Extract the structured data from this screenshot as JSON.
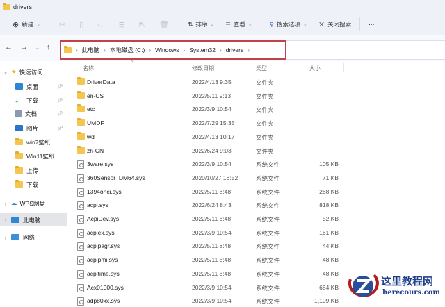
{
  "window": {
    "title": "drivers"
  },
  "toolbar": {
    "new_label": "新建",
    "sort_label": "排序",
    "view_label": "查看",
    "search_options_label": "搜索选项",
    "close_search_label": "关闭搜索",
    "more_label": "···"
  },
  "address": {
    "crumbs": [
      "此电脑",
      "本地磁盘 (C:)",
      "Windows",
      "System32",
      "drivers"
    ],
    "highlight_color": "#c0434c"
  },
  "sidebar": {
    "quick_access": "快速访问",
    "items": [
      {
        "label": "桌面",
        "icon": "desktop-icon",
        "pinned": true
      },
      {
        "label": "下载",
        "icon": "download-icon",
        "pinned": true
      },
      {
        "label": "文档",
        "icon": "document-icon",
        "pinned": true
      },
      {
        "label": "图片",
        "icon": "picture-icon",
        "pinned": true
      },
      {
        "label": "win7壁纸",
        "icon": "folder-icon"
      },
      {
        "label": "Win11壁纸",
        "icon": "folder-icon"
      },
      {
        "label": "上传",
        "icon": "folder-icon"
      },
      {
        "label": "下载",
        "icon": "folder-icon"
      }
    ],
    "wps": "WPS网盘",
    "this_pc": "此电脑",
    "network": "网络"
  },
  "columns": {
    "name": "名称",
    "date": "修改日期",
    "type": "类型",
    "size": "大小"
  },
  "files": [
    {
      "name": "DriverData",
      "date": "2022/4/13 9:35",
      "type": "文件夹",
      "size": "",
      "kind": "folder"
    },
    {
      "name": "en-US",
      "date": "2022/5/11 9:13",
      "type": "文件夹",
      "size": "",
      "kind": "folder"
    },
    {
      "name": "etc",
      "date": "2022/3/9 10:54",
      "type": "文件夹",
      "size": "",
      "kind": "folder"
    },
    {
      "name": "UMDF",
      "date": "2022/7/29 15:35",
      "type": "文件夹",
      "size": "",
      "kind": "folder"
    },
    {
      "name": "wd",
      "date": "2022/4/13 10:17",
      "type": "文件夹",
      "size": "",
      "kind": "folder"
    },
    {
      "name": "zh-CN",
      "date": "2022/6/24 9:03",
      "type": "文件夹",
      "size": "",
      "kind": "folder"
    },
    {
      "name": "3ware.sys",
      "date": "2022/3/9 10:54",
      "type": "系统文件",
      "size": "105 KB",
      "kind": "sys"
    },
    {
      "name": "360Sensor_DM64.sys",
      "date": "2020/10/27 16:52",
      "type": "系统文件",
      "size": "71 KB",
      "kind": "sys"
    },
    {
      "name": "1394ohci.sys",
      "date": "2022/5/11 8:48",
      "type": "系统文件",
      "size": "288 KB",
      "kind": "sys"
    },
    {
      "name": "acpi.sys",
      "date": "2022/6/24 8:43",
      "type": "系统文件",
      "size": "818 KB",
      "kind": "sys"
    },
    {
      "name": "AcpiDev.sys",
      "date": "2022/5/11 8:48",
      "type": "系统文件",
      "size": "52 KB",
      "kind": "sys"
    },
    {
      "name": "acpiex.sys",
      "date": "2022/3/9 10:54",
      "type": "系统文件",
      "size": "161 KB",
      "kind": "sys"
    },
    {
      "name": "acpipagr.sys",
      "date": "2022/5/11 8:48",
      "type": "系统文件",
      "size": "44 KB",
      "kind": "sys"
    },
    {
      "name": "acpipmi.sys",
      "date": "2022/5/11 8:48",
      "type": "系统文件",
      "size": "48 KB",
      "kind": "sys"
    },
    {
      "name": "acpitime.sys",
      "date": "2022/5/11 8:48",
      "type": "系统文件",
      "size": "48 KB",
      "kind": "sys"
    },
    {
      "name": "Acx01000.sys",
      "date": "2022/3/9 10:54",
      "type": "系统文件",
      "size": "684 KB",
      "kind": "sys"
    },
    {
      "name": "adp80xx.sys",
      "date": "2022/3/9 10:54",
      "type": "系统文件",
      "size": "1,109 KB",
      "kind": "sys"
    }
  ],
  "watermark": {
    "title": "这里教程网",
    "url": "herecours.com"
  }
}
